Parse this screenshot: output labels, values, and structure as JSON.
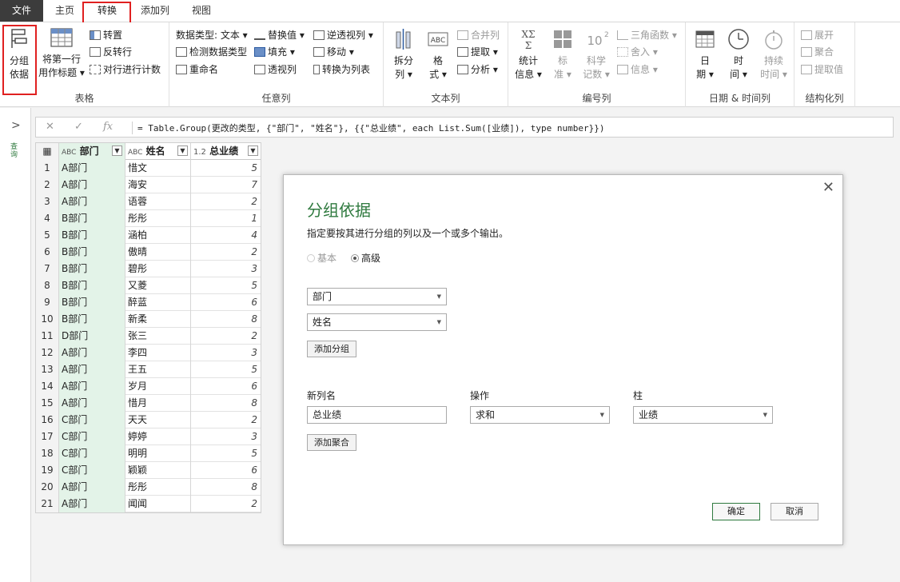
{
  "tabs": [
    "文件",
    "主页",
    "转换",
    "添加列",
    "视图"
  ],
  "ribbon": {
    "table": {
      "label": "表格",
      "group_by": [
        "分组",
        "依据"
      ],
      "use_first_row": [
        "将第一行",
        "用作标题 ▾"
      ],
      "transpose": "转置",
      "reverse_rows": "反转行",
      "count_rows": "对行进行计数"
    },
    "any_column": {
      "label": "任意列",
      "data_type": "数据类型: 文本 ▾",
      "detect_type": "检测数据类型",
      "rename": "重命名",
      "replace_values": "替换值 ▾",
      "fill": "填充 ▾",
      "pivot": "透视列",
      "unpivot": "逆透视列 ▾",
      "move": "移动 ▾",
      "to_list": "转换为列表"
    },
    "text_column": {
      "label": "文本列",
      "split": [
        "拆分",
        "列 ▾"
      ],
      "format": [
        "格",
        "式 ▾"
      ],
      "merge": "合并列",
      "extract": "提取 ▾",
      "parse": "分析 ▾"
    },
    "number_column": {
      "label": "编号列",
      "statistics": [
        "统计",
        "信息 ▾"
      ],
      "standard": [
        "标",
        "准 ▾"
      ],
      "scientific": [
        "科学",
        "记数 ▾"
      ],
      "trig": "三角函数 ▾",
      "rounding": "舍入 ▾",
      "info": "信息 ▾"
    },
    "datetime_column": {
      "label": "日期 & 时间列",
      "date": [
        "日",
        "期 ▾"
      ],
      "time": [
        "时",
        "间 ▾"
      ],
      "duration": [
        "持续",
        "时间 ▾"
      ]
    },
    "structured_column": {
      "label": "结构化列",
      "expand": "展开",
      "aggregate": "聚合",
      "extract_values": "提取值"
    }
  },
  "left_pane": {
    "label": "查询"
  },
  "formula_bar": {
    "cancel": "✕",
    "confirm": "✓",
    "fx": "fx",
    "formula": "= Table.Group(更改的类型, {\"部门\", \"姓名\"}, {{\"总业绩\", each List.Sum([业绩]), type number}})"
  },
  "grid": {
    "columns": [
      {
        "type": "ABC",
        "name": "部门"
      },
      {
        "type": "ABC",
        "name": "姓名"
      },
      {
        "type": "1.2",
        "name": "总业绩"
      }
    ],
    "rows": [
      [
        "1",
        "A部门",
        "惜文",
        "5"
      ],
      [
        "2",
        "A部门",
        "海安",
        "7"
      ],
      [
        "3",
        "A部门",
        "语蓉",
        "2"
      ],
      [
        "4",
        "B部门",
        "彤彤",
        "1"
      ],
      [
        "5",
        "B部门",
        "涵柏",
        "4"
      ],
      [
        "6",
        "B部门",
        "傲晴",
        "2"
      ],
      [
        "7",
        "B部门",
        "碧彤",
        "3"
      ],
      [
        "8",
        "B部门",
        "又菱",
        "5"
      ],
      [
        "9",
        "B部门",
        "醉蓝",
        "6"
      ],
      [
        "10",
        "B部门",
        "新柔",
        "8"
      ],
      [
        "11",
        "D部门",
        "张三",
        "2"
      ],
      [
        "12",
        "A部门",
        "李四",
        "3"
      ],
      [
        "13",
        "A部门",
        "王五",
        "5"
      ],
      [
        "14",
        "A部门",
        "岁月",
        "6"
      ],
      [
        "15",
        "A部门",
        "惜月",
        "8"
      ],
      [
        "16",
        "C部门",
        "天天",
        "2"
      ],
      [
        "17",
        "C部门",
        "婷婷",
        "3"
      ],
      [
        "18",
        "C部门",
        "明明",
        "5"
      ],
      [
        "19",
        "C部门",
        "颖颖",
        "6"
      ],
      [
        "20",
        "A部门",
        "彤彤",
        "8"
      ],
      [
        "21",
        "A部门",
        "闻闻",
        "2"
      ]
    ]
  },
  "dialog": {
    "title": "分组依据",
    "description": "指定要按其进行分组的列以及一个或多个输出。",
    "radio_basic": "基本",
    "radio_advanced": "高级",
    "group_fields": [
      "部门",
      "姓名"
    ],
    "add_group": "添加分组",
    "new_col_label": "新列名",
    "op_label": "操作",
    "col_label": "柱",
    "new_col_value": "总业绩",
    "op_value": "求和",
    "col_value": "业绩",
    "add_aggregation": "添加聚合",
    "ok": "确定",
    "cancel": "取消",
    "close": "✕"
  },
  "colors": {
    "accent": "#2f7a3f",
    "highlight": "#e02020",
    "column_select": "#e3f3e8"
  }
}
